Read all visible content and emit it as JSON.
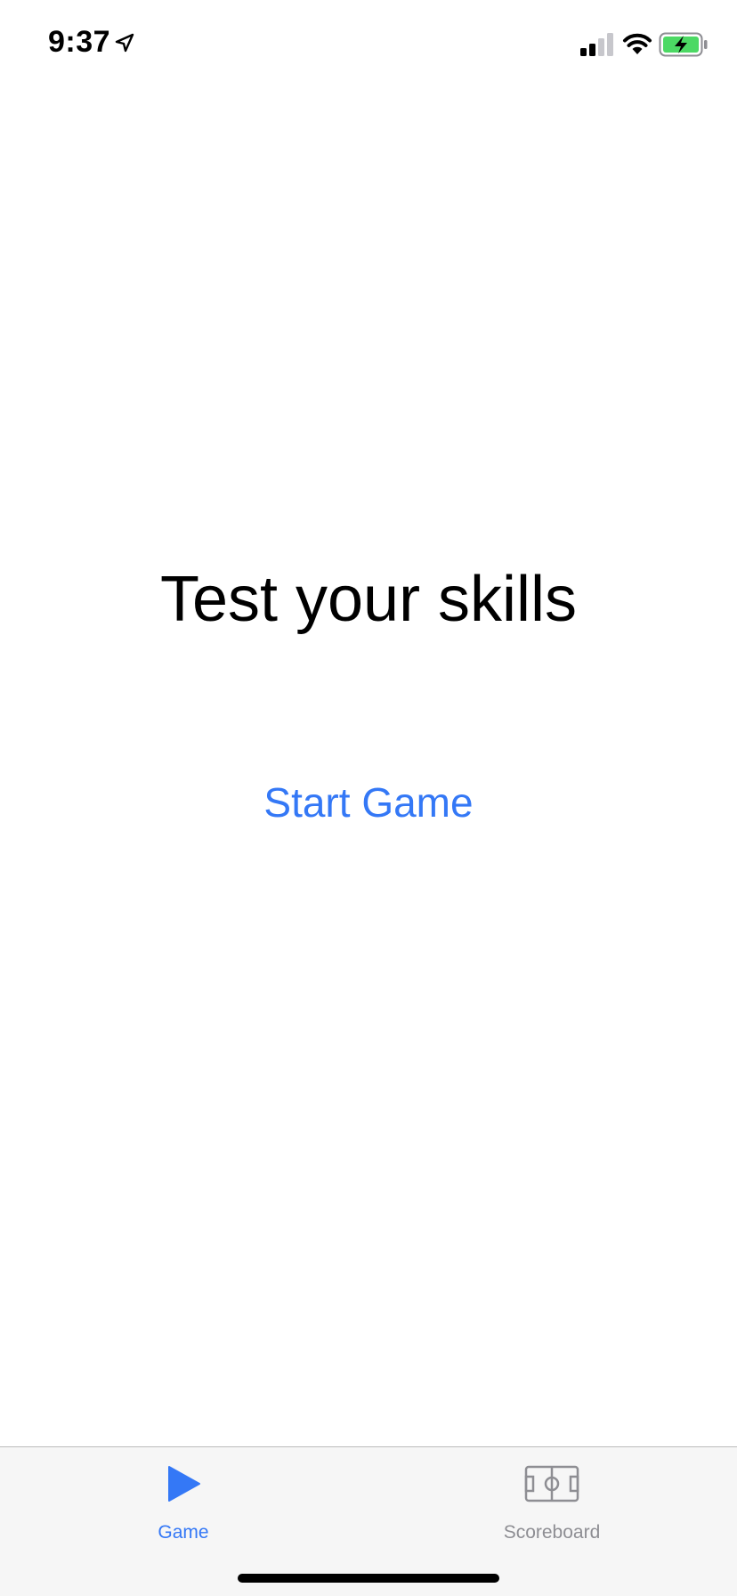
{
  "status_bar": {
    "time": "9:37",
    "icons": [
      "location-arrow-icon",
      "cellular-signal-icon",
      "wifi-icon",
      "battery-charging-icon"
    ],
    "battery_color": "#4cd964"
  },
  "main": {
    "title": "Test your skills",
    "start_button_label": "Start Game"
  },
  "tab_bar": {
    "tabs": [
      {
        "label": "Game",
        "icon": "play-icon",
        "active": true
      },
      {
        "label": "Scoreboard",
        "icon": "field-icon",
        "active": false
      }
    ]
  },
  "colors": {
    "accent": "#3478f6",
    "inactive": "#8e8e93",
    "tab_bar_bg": "#f6f6f6"
  }
}
